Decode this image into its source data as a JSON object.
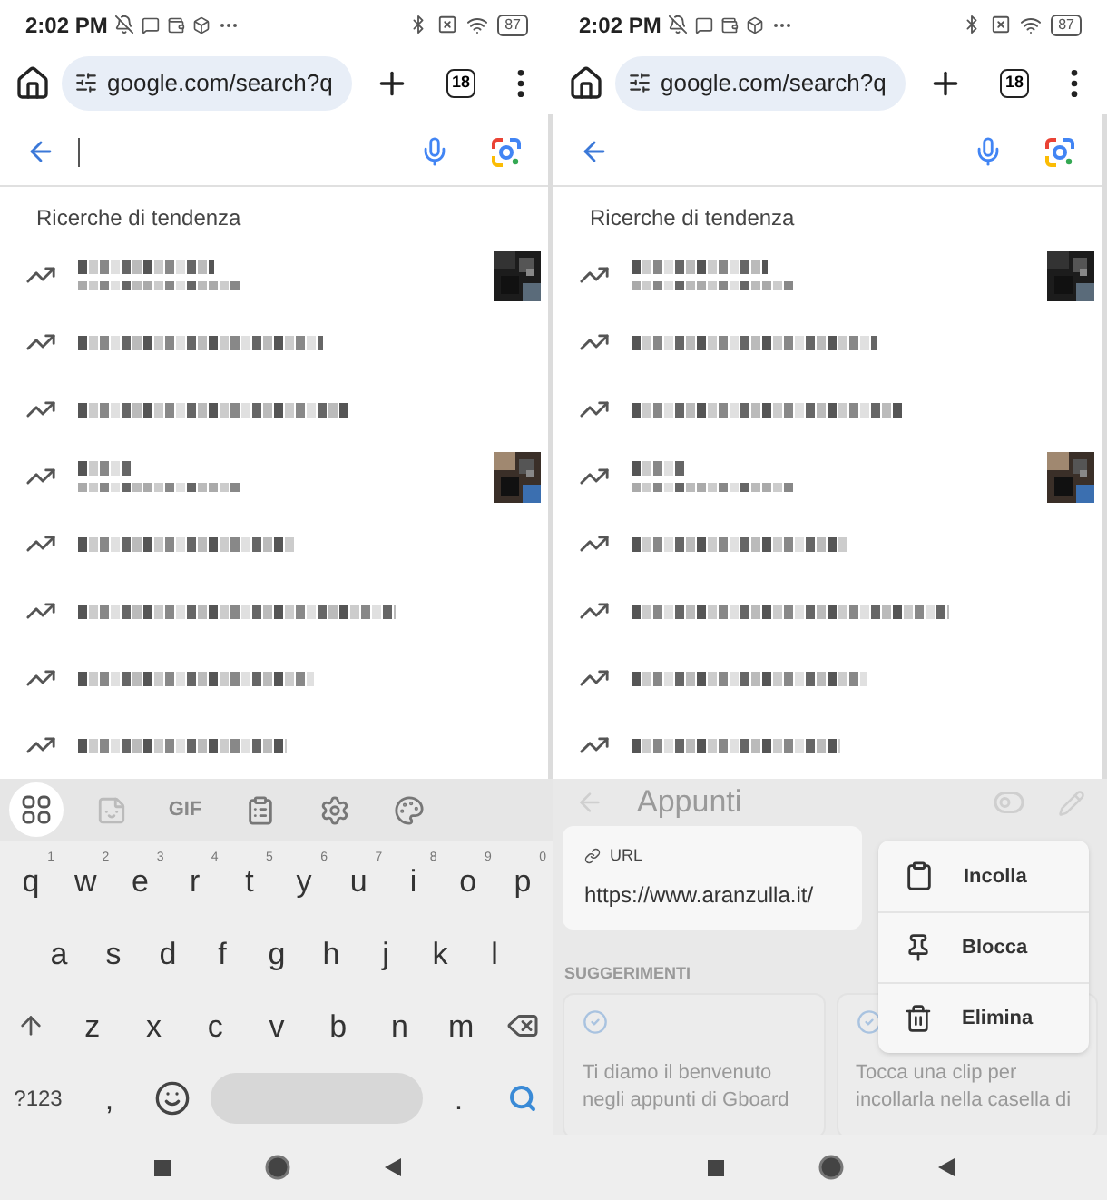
{
  "screens": [
    {
      "status_bar": {
        "time": "2:02 PM",
        "battery": "87"
      },
      "toolbar": {
        "url": "google.com/search?q",
        "tab_count": "18"
      },
      "search": {
        "cursor": true
      },
      "trending": {
        "heading": "Ricerche di tendenza",
        "items": [
          {
            "subtitle": true,
            "thumbnail": true
          },
          {
            "subtitle": false,
            "thumbnail": false
          },
          {
            "subtitle": false,
            "thumbnail": false
          },
          {
            "subtitle": true,
            "thumbnail": true
          },
          {
            "subtitle": false,
            "thumbnail": false
          },
          {
            "subtitle": false,
            "thumbnail": false
          },
          {
            "subtitle": false,
            "thumbnail": false
          },
          {
            "subtitle": false,
            "thumbnail": false
          }
        ]
      },
      "panel": {
        "kind": "keyboard",
        "tools": [
          {
            "kind": "grid",
            "selected": true
          },
          {
            "kind": "sticker",
            "selected": false
          },
          {
            "kind": "gif",
            "label": "GIF",
            "selected": false
          },
          {
            "kind": "clipboard",
            "selected": false
          },
          {
            "kind": "settings",
            "selected": false
          },
          {
            "kind": "palette",
            "selected": false
          }
        ],
        "rows": [
          [
            {
              "label": "q",
              "hint": "1"
            },
            {
              "label": "w",
              "hint": "2"
            },
            {
              "label": "e",
              "hint": "3"
            },
            {
              "label": "r",
              "hint": "4"
            },
            {
              "label": "t",
              "hint": "5"
            },
            {
              "label": "y",
              "hint": "6"
            },
            {
              "label": "u",
              "hint": "7"
            },
            {
              "label": "i",
              "hint": "8"
            },
            {
              "label": "o",
              "hint": "9"
            },
            {
              "label": "p",
              "hint": "0"
            }
          ],
          [
            {
              "label": "a"
            },
            {
              "label": "s"
            },
            {
              "label": "d"
            },
            {
              "label": "f"
            },
            {
              "label": "g"
            },
            {
              "label": "h"
            },
            {
              "label": "j"
            },
            {
              "label": "k"
            },
            {
              "label": "l"
            }
          ],
          [
            {
              "kind": "shift"
            },
            {
              "label": "z"
            },
            {
              "label": "x"
            },
            {
              "label": "c"
            },
            {
              "label": "v"
            },
            {
              "label": "b"
            },
            {
              "label": "n"
            },
            {
              "label": "m"
            },
            {
              "kind": "backspace"
            }
          ],
          [
            {
              "kind": "symbols",
              "label": "?123"
            },
            {
              "label": ","
            },
            {
              "kind": "emoji"
            },
            {
              "kind": "space"
            },
            {
              "label": "."
            },
            {
              "kind": "search"
            }
          ]
        ]
      }
    },
    {
      "status_bar": {
        "time": "2:02 PM",
        "battery": "87"
      },
      "toolbar": {
        "url": "google.com/search?q",
        "tab_count": "18"
      },
      "search": {
        "cursor": false
      },
      "trending": {
        "heading": "Ricerche di tendenza",
        "items": [
          {
            "subtitle": true,
            "thumbnail": true
          },
          {
            "subtitle": false,
            "thumbnail": false
          },
          {
            "subtitle": false,
            "thumbnail": false
          },
          {
            "subtitle": true,
            "thumbnail": true
          },
          {
            "subtitle": false,
            "thumbnail": false
          },
          {
            "subtitle": false,
            "thumbnail": false
          },
          {
            "subtitle": false,
            "thumbnail": false
          },
          {
            "subtitle": false,
            "thumbnail": false
          }
        ]
      },
      "panel": {
        "kind": "clipboard",
        "title": "Appunti",
        "clip": {
          "type": "URL",
          "text": "https://www.aranzulla.it/"
        },
        "menu": [
          {
            "kind": "paste",
            "label": "Incolla"
          },
          {
            "kind": "pin",
            "label": "Blocca"
          },
          {
            "kind": "delete",
            "label": "Elimina"
          }
        ],
        "suggestions_heading": "SUGGERIMENTI",
        "suggestions": [
          "Ti diamo il benvenuto negli appunti di Gboard",
          "Tocca una clip per incollarla nella casella di"
        ]
      }
    }
  ]
}
